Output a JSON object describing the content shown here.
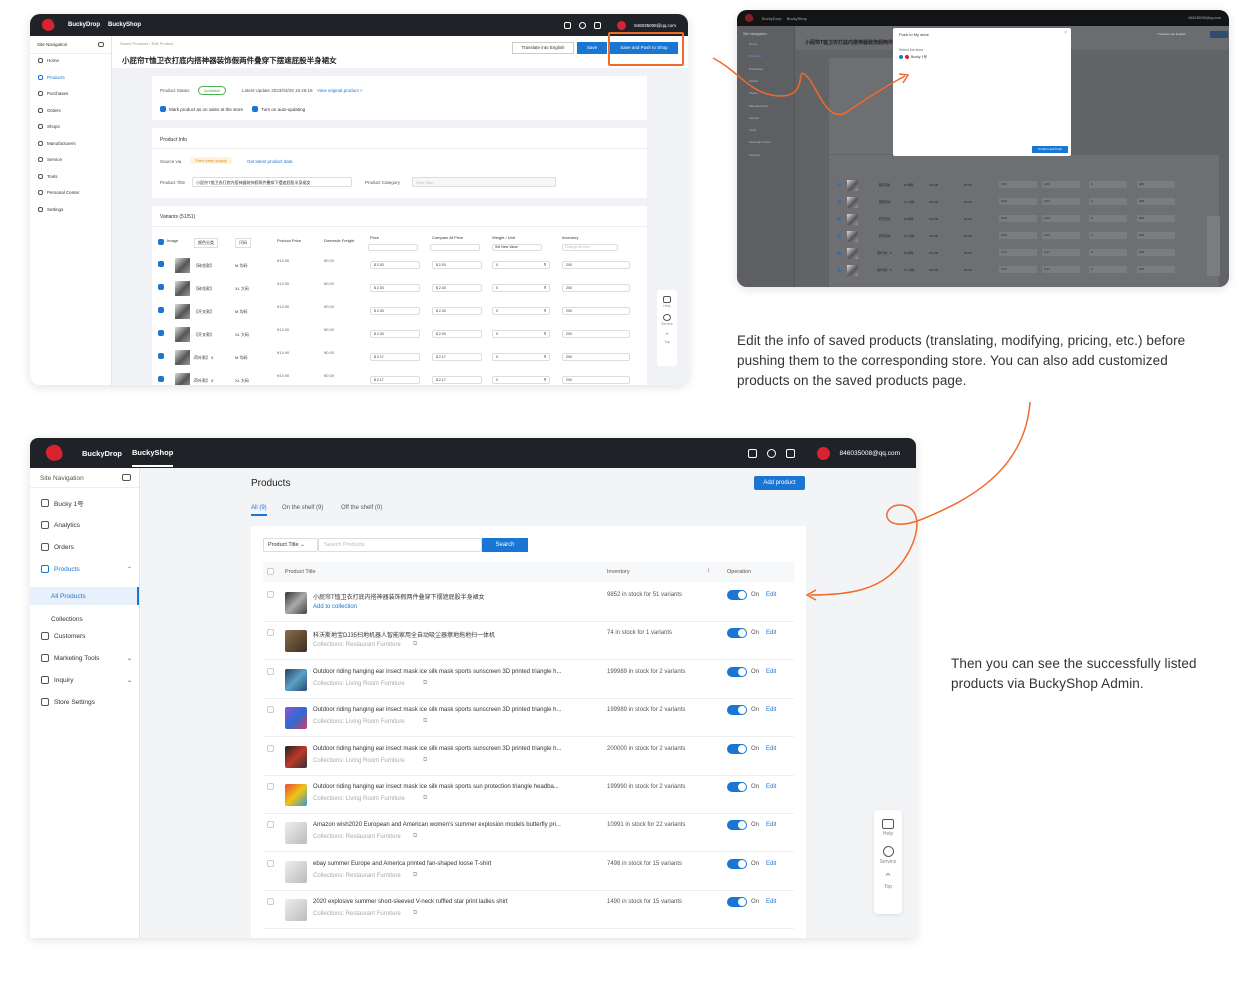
{
  "captions": {
    "top": "Edit the info of saved products (translating, modifying, pricing, etc.) before pushing them to the corresponding store. You can also add customized products on the saved products page.",
    "bottom": "Then you can see the successfully listed products via BuckyShop Admin."
  },
  "app": {
    "brand1": "BuckyDrop",
    "brand2": "BuckyShop",
    "user_email": "846035008@qq.com"
  },
  "site_nav": "Site Navigation",
  "edit_page": {
    "breadcrumb": [
      "Saved Products",
      "Edit Product"
    ],
    "title": "小屁帘T恤卫衣打底内搭神器装饰假两件叠穿下摆遮屁股半身裙女",
    "btn_translate": "Translate into English",
    "btn_save": "Save",
    "btn_save_push": "Save and Push to Shop",
    "sidebar": [
      "Home",
      "Products",
      "Purchases",
      "Orders",
      "Shops",
      "Manufacturers",
      "Service",
      "Tools",
      "Personal Center",
      "Settings"
    ],
    "status_label": "Product Status",
    "status_badge": "Available",
    "latest_update": "Latest Update 2023/03/28 15:26:19",
    "view_original": "View original product >",
    "mark_sales": "Mark product as on sales at the store",
    "auto_update": "Turn on auto-updating",
    "product_info": "Product Info",
    "source_label": "Source via",
    "source_badge": "Third party supply",
    "get_latest": "Get latest product data",
    "title_label": "Product Title",
    "title_value": "小屁帘T恤卫衣打底内搭神器装饰假两件叠穿下摆遮屁股半身裙女",
    "category_label": "Product Category",
    "category_placeholder": "Shirt Shirt",
    "variants_title": "Variants (51/51)",
    "col_headers": [
      "Image",
      "颜色分类",
      "尺码",
      "Product Price",
      "Domestic Freight",
      "Price",
      "Compare At Price",
      "Weight / Unit",
      "Inventory"
    ],
    "weight_ph": "Set New Value",
    "inv_ph": "Change all Inve...",
    "rows": [
      [
        "【碎花款】",
        "M 均码",
        "¥13.90",
        "¥0.00",
        "2.03",
        "2.03",
        "0",
        "200"
      ],
      [
        "【碎花款】",
        "XL 大码",
        "¥13.90",
        "¥0.00",
        "2.03",
        "2.03",
        "0",
        "200"
      ],
      [
        "【开叉款】",
        "M 均码",
        "¥13.90",
        "¥0.00",
        "2.03",
        "2.03",
        "0",
        "200"
      ],
      [
        "【开叉款】",
        "XL 大码",
        "¥13.90",
        "¥0.00",
        "2.03",
        "2.03",
        "0",
        "200"
      ],
      [
        "荷叶款】 5",
        "M 均码",
        "¥14.90",
        "¥0.00",
        "2.17",
        "2.17",
        "0",
        "200"
      ],
      [
        "荷叶款】 5",
        "XL 大码",
        "¥14.90",
        "¥0.00",
        "2.17",
        "2.17",
        "0",
        "200"
      ]
    ],
    "float": [
      "Help",
      "Service",
      "Top"
    ]
  },
  "modal": {
    "title": "Push to My store",
    "select": "Select the store",
    "store": "Bucky 1号",
    "confirm": "Confirm and Push"
  },
  "admin": {
    "page_title": "Products",
    "add_button": "Add product",
    "tabs": [
      "All (9)",
      "On the shelf (9)",
      "Off the shelf (0)"
    ],
    "filter_select": "Product Title",
    "search_ph": "Search Products",
    "search_btn": "Search",
    "headers": {
      "title": "Product Title",
      "inventory": "Inventory",
      "operation": "Operation"
    },
    "sidebar": {
      "store": "Bucky 1号",
      "items": [
        "Analytics",
        "Orders",
        "Products",
        "All Products",
        "Collections",
        "Customers",
        "Marketing Tools",
        "Inquiry",
        "Store Settings"
      ]
    },
    "on_label": "On",
    "edit_label": "Edit",
    "products": [
      {
        "title": "小屁帘T恤卫衣打底内搭神器装饰假两件叠穿下摆遮屁股半身裙女",
        "sub": "Add to collection",
        "inv": "9852 in stock for 51 variants"
      },
      {
        "title": "科沃斯地宝DJ35扫地机器人智能家用全自动吸尘器擦地拖地扫一体机",
        "sub": "Collections: Restaurant Furniture",
        "inv": "74 in stock for 1 variants"
      },
      {
        "title": "Outdoor riding hanging ear insect mask ice silk mask sports sunscreen 3D printed triangle h...",
        "sub": "Collections: Living Room Furniture",
        "inv": "199989 in stock for 2 variants"
      },
      {
        "title": "Outdoor riding hanging ear insect mask ice silk mask sports sunscreen 3D printed triangle h...",
        "sub": "Collections: Living Room Furniture",
        "inv": "199989 in stock for 2 variants"
      },
      {
        "title": "Outdoor riding hanging ear insect mask ice silk mask sports sunscreen 3D printed triangle h...",
        "sub": "Collections: Living Room Furniture",
        "inv": "200000 in stock for 2 variants"
      },
      {
        "title": "Outdoor riding hanging ear insect mask ice silk mask sports sun protection triangle headba...",
        "sub": "Collections: Living Room Furniture",
        "inv": "199990 in stock for 2 variants"
      },
      {
        "title": "Amazon wish2020 European and American women's summer explosion models butterfly pri...",
        "sub": "Collections: Restaurant Furniture",
        "inv": "10991 in stock for 22 variants"
      },
      {
        "title": "ebay summer Europe and America printed fan-shaped loose T-shirt",
        "sub": "Collections: Restaurant Furniture",
        "inv": "7498 in stock for 15 variants"
      },
      {
        "title": "2020 explosive summer short-sleeved V-neck ruffled star print ladies shirt",
        "sub": "Collections: Restaurant Furniture",
        "inv": "1490 in stock for 15 variants"
      }
    ],
    "float": [
      "Help",
      "Service",
      "Top"
    ]
  },
  "colors": {
    "accent": "#1976d2",
    "topbar": "#1f2328",
    "arrow": "#f06a2a",
    "highlight": "#f06a2a"
  }
}
